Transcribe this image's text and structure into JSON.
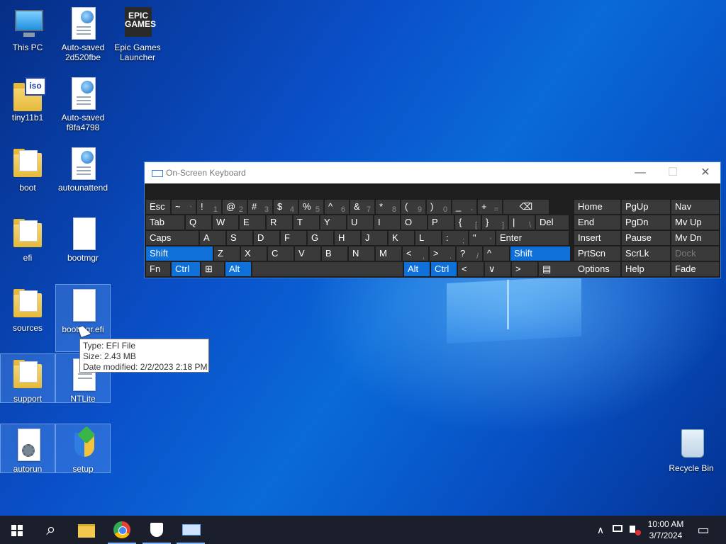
{
  "desktop": {
    "icons": [
      {
        "label": "This PC"
      },
      {
        "label": "Auto-saved 2d520fbe"
      },
      {
        "label": "Epic Games Launcher"
      },
      {
        "label": "tiny11b1"
      },
      {
        "label": "Auto-saved f8fa4798"
      },
      {
        "label": "boot"
      },
      {
        "label": "autounattend"
      },
      {
        "label": "efi"
      },
      {
        "label": "bootmgr"
      },
      {
        "label": "sources"
      },
      {
        "label": "bootmgr.efi"
      },
      {
        "label": "support"
      },
      {
        "label": "NTLite"
      },
      {
        "label": "autorun"
      },
      {
        "label": "setup"
      },
      {
        "label": "Recycle Bin"
      }
    ],
    "epic_logo_text": "EPIC GAMES",
    "iso_badge": "iso"
  },
  "tooltip": {
    "type": "Type: EFI File",
    "size": "Size: 2.43 MB",
    "modified": "Date modified: 2/2/2023 2:18 PM"
  },
  "osk": {
    "title": "On-Screen Keyboard",
    "buttons": {
      "minimize": "—",
      "maximize": "☐",
      "close": "✕"
    },
    "row1": [
      {
        "main": "Esc",
        "sub": ""
      },
      {
        "main": "~",
        "sub": "`"
      },
      {
        "main": "!",
        "sub": "1"
      },
      {
        "main": "@",
        "sub": "2"
      },
      {
        "main": "#",
        "sub": "3"
      },
      {
        "main": "$",
        "sub": "4"
      },
      {
        "main": "%",
        "sub": "5"
      },
      {
        "main": "^",
        "sub": "6"
      },
      {
        "main": "&",
        "sub": "7"
      },
      {
        "main": "*",
        "sub": "8"
      },
      {
        "main": "(",
        "sub": "9"
      },
      {
        "main": ")",
        "sub": "0"
      },
      {
        "main": "_",
        "sub": "-"
      },
      {
        "main": "+",
        "sub": "="
      },
      {
        "main": "⌫",
        "sub": ""
      }
    ],
    "row2": [
      "Tab",
      "Q",
      "W",
      "E",
      "R",
      "T",
      "Y",
      "U",
      "I",
      "O",
      "P",
      "{",
      "}",
      "|",
      "Del"
    ],
    "row2_subs": {
      "11": "[",
      "12": "]",
      "13": "\\"
    },
    "row3": [
      "Caps",
      "A",
      "S",
      "D",
      "F",
      "G",
      "H",
      "J",
      "K",
      "L",
      ":",
      "\"",
      "Enter"
    ],
    "row3_subs": {
      "10": ";",
      "11": "'"
    },
    "row4": [
      "Shift",
      "Z",
      "X",
      "C",
      "V",
      "B",
      "N",
      "M",
      "<",
      ">",
      "?",
      "^",
      "Shift"
    ],
    "row4_subs": {
      "8": ",",
      "9": ".",
      "10": "/"
    },
    "row5": [
      "Fn",
      "Ctrl",
      "⊞",
      "Alt",
      "",
      "Alt",
      "Ctrl",
      "<",
      "∨",
      ">",
      "▤"
    ],
    "nav": [
      [
        "Home",
        "PgUp",
        "Nav"
      ],
      [
        "End",
        "PgDn",
        "Mv Up"
      ],
      [
        "Insert",
        "Pause",
        "Mv Dn"
      ],
      [
        "PrtScn",
        "ScrLk",
        "Dock"
      ],
      [
        "Options",
        "Help",
        "Fade"
      ]
    ]
  },
  "taskbar": {
    "search_glyph": "⌕",
    "time": "10:00 AM",
    "date": "3/7/2024",
    "tray_chevron": "∧",
    "notification_glyph": "▭"
  }
}
